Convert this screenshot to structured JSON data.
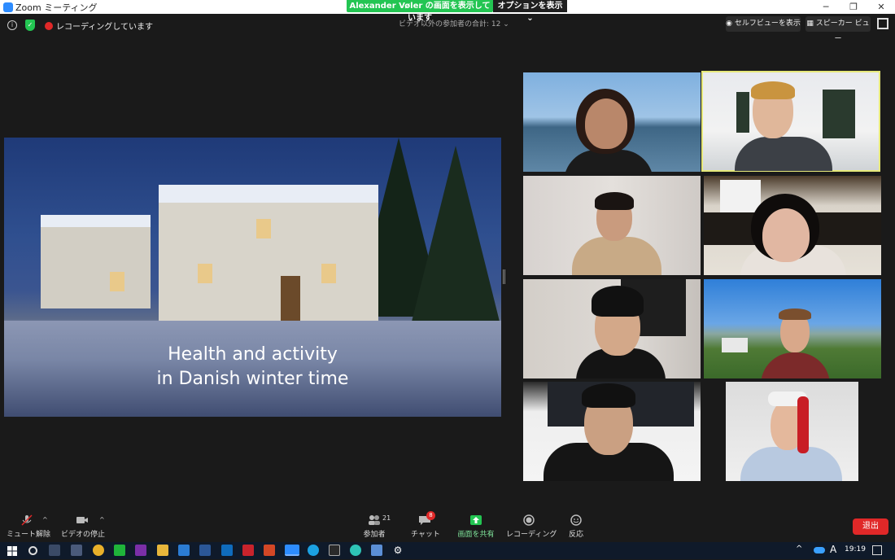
{
  "window": {
    "title": "Zoom ミーティング"
  },
  "banner": {
    "sharing_text": "Alexander Vøler の画面を表示しています",
    "options_label": "オプションを表示 ⌄"
  },
  "topbar": {
    "recording_text": "レコーディングしています",
    "participants_count": "ビデオ以外の参加者の合計: 12 ⌄",
    "selfview_label": "セルフビューを表示",
    "speaker_view_label": "スピーカー ビュー"
  },
  "slide": {
    "title_line1": "Health and activity",
    "title_line2": "in Danish winter time"
  },
  "toolbar": {
    "mute_label": "ミュート解除",
    "video_label": "ビデオの停止",
    "participants_label": "参加者",
    "participants_badge": "21",
    "chat_label": "チャット",
    "chat_badge": "8",
    "share_label": "画面を共有",
    "record_label": "レコーディング",
    "reactions_label": "反応",
    "leave_label": "退出"
  },
  "taskbar": {
    "time": "19:19"
  },
  "colors": {
    "accent_green": "#23c552",
    "leave_red": "#e02828",
    "active_speaker": "#e6e87a"
  }
}
